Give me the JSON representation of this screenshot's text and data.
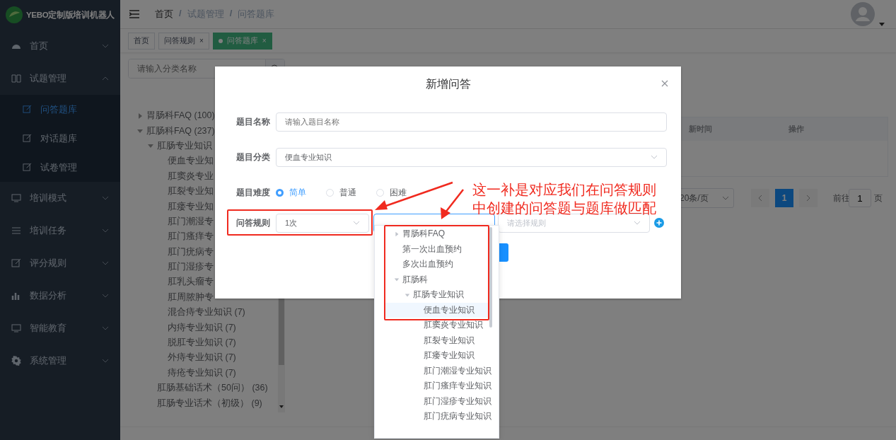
{
  "app": {
    "title": "YEBO定制版培训机器人"
  },
  "sidebar": {
    "items": [
      {
        "label": "首页",
        "expanded": false,
        "selected": false
      },
      {
        "label": "试题管理",
        "expanded": true,
        "selected": false,
        "children": [
          {
            "label": "问答题库",
            "selected": true
          },
          {
            "label": "对话题库",
            "selected": false
          },
          {
            "label": "试卷管理",
            "selected": false
          }
        ]
      },
      {
        "label": "培训模式",
        "expanded": false,
        "selected": false
      },
      {
        "label": "培训任务",
        "expanded": false,
        "selected": false
      },
      {
        "label": "评分规则",
        "expanded": false,
        "selected": false
      },
      {
        "label": "数据分析",
        "expanded": false,
        "selected": false
      },
      {
        "label": "智能教育",
        "expanded": false,
        "selected": false
      },
      {
        "label": "系统管理",
        "expanded": false,
        "selected": false
      }
    ]
  },
  "breadcrumb": {
    "items": [
      "首页",
      "试题管理",
      "问答题库"
    ],
    "separator": "/"
  },
  "tabs": [
    {
      "label": "首页",
      "selected": false
    },
    {
      "label": "问答规则",
      "close": "×",
      "selected": false
    },
    {
      "label": "问答题库",
      "close": "×",
      "selected": true
    }
  ],
  "category_panel": {
    "search": {
      "placeholder": "请输入分类名称"
    },
    "tree": [
      {
        "label": "胃肠科FAQ (100)",
        "expanded": false
      },
      {
        "label": "肛肠科FAQ (237)",
        "expanded": true,
        "children": [
          {
            "label": "肛肠专业知识",
            "expanded": true,
            "children": [
              {
                "label": "便血专业知"
              },
              {
                "label": "肛窦炎专业"
              },
              {
                "label": "肛裂专业知"
              },
              {
                "label": "肛瘘专业知"
              },
              {
                "label": "肛门潮湿专"
              },
              {
                "label": "肛门瘙痒专"
              },
              {
                "label": "肛门疣病专"
              },
              {
                "label": "肛门湿疹专"
              },
              {
                "label": "肛乳头瘤专"
              },
              {
                "label": "肛周脓肿专"
              },
              {
                "label": "混合痔专业知识 (7)"
              },
              {
                "label": "内痔专业知识 (7)"
              },
              {
                "label": "脱肛专业知识 (7)"
              },
              {
                "label": "外痔专业知识 (7)"
              },
              {
                "label": "痔疮专业知识 (7)"
              }
            ]
          },
          {
            "label": "肛肠基础话术（50问） (36)"
          },
          {
            "label": "肛肠专业话术（初级） (9)"
          }
        ]
      }
    ]
  },
  "table": {
    "columns": [
      "新时间",
      "操作"
    ]
  },
  "pagination": {
    "page_size": "20条/页",
    "pages": [
      {
        "label": "1",
        "selected": true
      }
    ],
    "goto_label": "前往",
    "goto_value": "1",
    "goto_suffix": "页"
  },
  "modal": {
    "title": "新增问答",
    "fields": [
      {
        "kind": "input",
        "label": "题目名称",
        "placeholder": "请输入题目名称"
      },
      {
        "kind": "select",
        "label": "题目分类",
        "value": "便血专业知识"
      },
      {
        "kind": "radio",
        "label": "题目难度",
        "options": [
          {
            "label": "简单",
            "selected": true
          },
          {
            "label": "普通",
            "selected": false
          },
          {
            "label": "困难",
            "selected": false
          }
        ]
      },
      {
        "kind": "rule",
        "label": "问答规则",
        "value": "1次",
        "placeholder": "请选择规则"
      }
    ],
    "dropdown": [
      {
        "label": "胃肠科FAQ",
        "expanded": false,
        "selected": false
      },
      {
        "label": "第一次出血预约",
        "selected": false
      },
      {
        "label": "多次出血预约",
        "selected": false
      },
      {
        "label": "肛肠科",
        "expanded": true,
        "selected": false,
        "children": [
          {
            "label": "肛肠专业知识",
            "expanded": true,
            "selected": false,
            "children": [
              {
                "label": "便血专业知识",
                "selected": true
              },
              {
                "label": "肛窦炎专业知识",
                "selected": false
              },
              {
                "label": "肛裂专业知识",
                "selected": false
              },
              {
                "label": "肛瘘专业知识",
                "selected": false
              },
              {
                "label": "肛门潮湿专业知识",
                "selected": false
              },
              {
                "label": "肛门瘙痒专业知识",
                "selected": false
              },
              {
                "label": "肛门湿疹专业知识",
                "selected": false
              },
              {
                "label": "肛门疣病专业知识",
                "selected": false
              }
            ]
          }
        ]
      }
    ]
  },
  "annotation": {
    "lines": [
      "这一补是对应我们在问答规则",
      "中创建的问答题与题库做匹配"
    ]
  }
}
